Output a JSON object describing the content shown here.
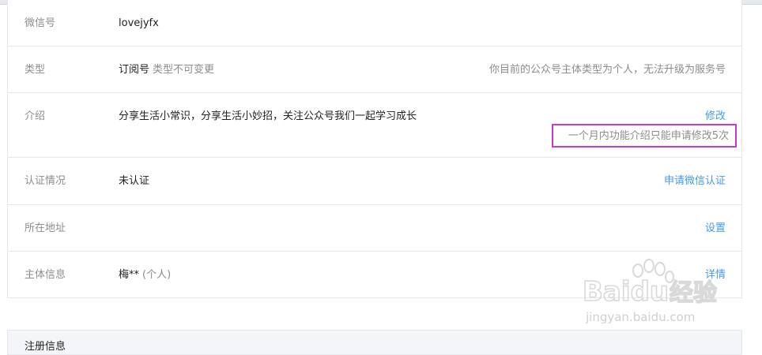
{
  "rows": [
    {
      "label": "微信号",
      "value": "lovejyfx"
    },
    {
      "label": "类型",
      "value": "订阅号",
      "sub": "类型不可变更",
      "note": "你目前的公众号主体类型为个人，无法升级为服务号"
    },
    {
      "label": "介绍",
      "value": "分享生活小常识，分享生活小妙招，关注公众号我们一起学习成长",
      "action": "修改",
      "highlight_note": "一个月内功能介绍只能申请修改5次"
    },
    {
      "label": "认证情况",
      "value": "未认证",
      "action": "申请微信认证"
    },
    {
      "label": "所在地址",
      "value": "",
      "action": "设置"
    },
    {
      "label": "主体信息",
      "value": "梅**",
      "sub": "(个人)",
      "action": "详情"
    }
  ],
  "bottom_section": {
    "title": "注册信息"
  },
  "watermark": {
    "brand": "Baidu",
    "brand_cn": "经验",
    "url": "jingyan.baidu.com"
  },
  "colors": {
    "link": "#459ae9",
    "highlight_border": "#c53bc9",
    "label": "#8d8d8d"
  }
}
